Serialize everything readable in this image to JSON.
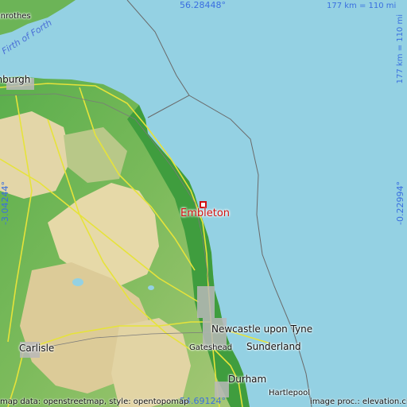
{
  "map": {
    "colors": {
      "sea": "#94d1e3",
      "lowland": "#4fa84a",
      "upland": "#e8dcb0",
      "marker": "#d01010",
      "coord_text": "#3a6fe0"
    },
    "coords": {
      "top": "56.28448°",
      "bottom": "54.69124°",
      "left": "-3.04244°",
      "right": "-0.22994°"
    },
    "scale": {
      "horizontal": "177 km = 110 mi",
      "vertical": "177 km = 110 mi"
    },
    "marker": {
      "name": "Embleton",
      "icon": "square-marker-icon"
    },
    "places": {
      "edinburgh": "Edinburgh",
      "rothes": "Glenrothes",
      "newcastle": "Newcastle upon Tyne",
      "gateshead": "Gateshead",
      "sunderland": "Sunderland",
      "carlisle": "Carlisle",
      "durham": "Durham",
      "hartlepool": "Hartlepool"
    },
    "water": {
      "firth": "Firth of Forth"
    },
    "footer": {
      "left": "map data: openstreetmap, style: opentopomap",
      "right": "image proc.: elevation.city"
    }
  }
}
